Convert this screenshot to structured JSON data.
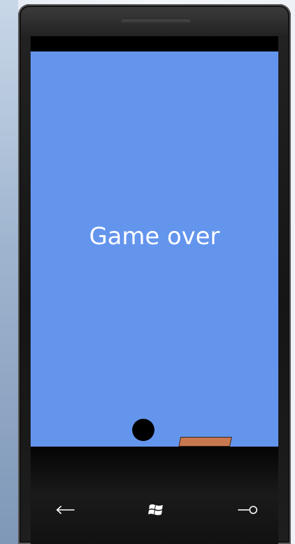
{
  "game": {
    "status_text": "Game over",
    "background_color": "#6495ed",
    "ball_color": "#000000",
    "paddle_color": "#c87850"
  },
  "navigation": {
    "back_icon": "back-arrow-icon",
    "start_icon": "windows-logo-icon",
    "search_icon": "search-icon"
  }
}
